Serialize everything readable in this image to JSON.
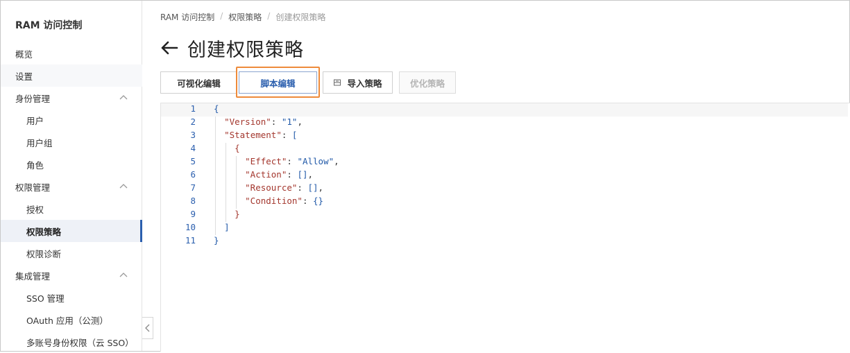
{
  "sidebar": {
    "title": "RAM 访问控制",
    "items": [
      {
        "label": "概览"
      },
      {
        "label": "设置"
      },
      {
        "label": "身份管理"
      },
      {
        "label": "用户"
      },
      {
        "label": "用户组"
      },
      {
        "label": "角色"
      },
      {
        "label": "权限管理"
      },
      {
        "label": "授权"
      },
      {
        "label": "权限策略"
      },
      {
        "label": "权限诊断"
      },
      {
        "label": "集成管理"
      },
      {
        "label": "SSO 管理"
      },
      {
        "label": "OAuth 应用（公测）"
      },
      {
        "label": "多账号身份权限（云 SSO）"
      }
    ]
  },
  "breadcrumb": [
    "RAM 访问控制",
    "权限策略",
    "创建权限策略"
  ],
  "page_title": "创建权限策略",
  "tabs": {
    "visual": "可视化编辑",
    "script": "脚本编辑",
    "import": "导入策略",
    "optimize": "优化策略"
  },
  "editor": {
    "line_numbers": [
      "1",
      "2",
      "3",
      "4",
      "5",
      "6",
      "7",
      "8",
      "9",
      "10",
      "11"
    ],
    "tokens": {
      "l1": "{",
      "l2_key": "\"Version\"",
      "l2_colon": ": ",
      "l2_val": "\"1\"",
      "l2_end": ",",
      "l3_key": "\"Statement\"",
      "l3_colon": ": ",
      "l3_val": "[",
      "l4": "{",
      "l5_key": "\"Effect\"",
      "l5_colon": ": ",
      "l5_val": "\"Allow\"",
      "l5_end": ",",
      "l6_key": "\"Action\"",
      "l6_colon": ": ",
      "l6_val": "[]",
      "l6_end": ",",
      "l7_key": "\"Resource\"",
      "l7_colon": ": ",
      "l7_val": "[]",
      "l7_end": ",",
      "l8_key": "\"Condition\"",
      "l8_colon": ": ",
      "l8_val": "{}",
      "l9": "}",
      "l10": "]",
      "l11": "}"
    }
  },
  "colors": {
    "accent": "#2b5fae",
    "highlight_border": "#ee8a3a",
    "json_key": "#a3362d",
    "json_value": "#2159a8"
  }
}
